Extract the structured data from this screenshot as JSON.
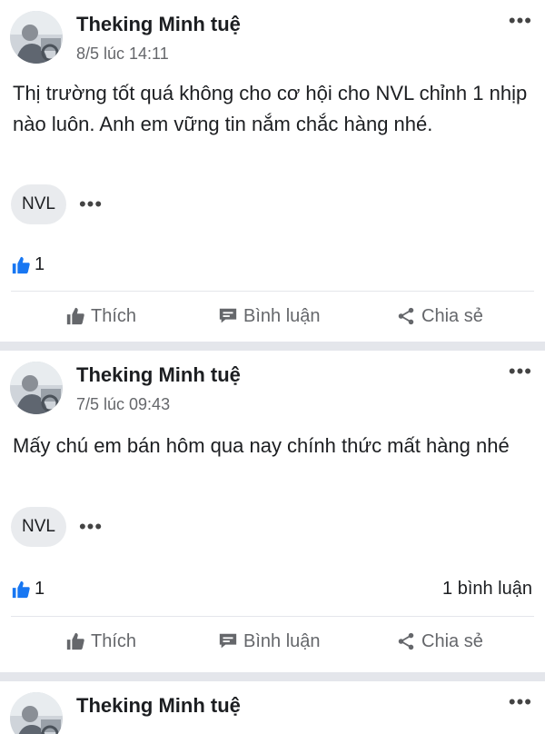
{
  "posts": [
    {
      "author": "Theking Minh tuệ",
      "time": "8/5 lúc 14:11",
      "content": "Thị trường tốt quá không cho cơ hội cho NVL chỉnh 1 nhịp nào luôn.  Anh em vững tin nắm chắc hàng nhé.",
      "tag": "NVL",
      "like_count": "1",
      "comment_count": ""
    },
    {
      "author": "Theking Minh tuệ",
      "time": "7/5 lúc 09:43",
      "content": "Mấy chú em bán hôm qua nay chính thức mất hàng nhé",
      "tag": "NVL",
      "like_count": "1",
      "comment_count": "1 bình luận"
    },
    {
      "author": "Theking Minh tuệ"
    }
  ],
  "actions": {
    "like": "Thích",
    "comment": "Bình luận",
    "share": "Chia sẻ"
  },
  "icons": {
    "more": "more-dots-icon",
    "like": "thumbs-up-icon",
    "comment": "comment-icon",
    "share": "share-icon"
  },
  "colors": {
    "accent": "#1877f2",
    "muted": "#65676b",
    "divider": "#e4e6eb",
    "tag_bg": "#e9ebee"
  }
}
